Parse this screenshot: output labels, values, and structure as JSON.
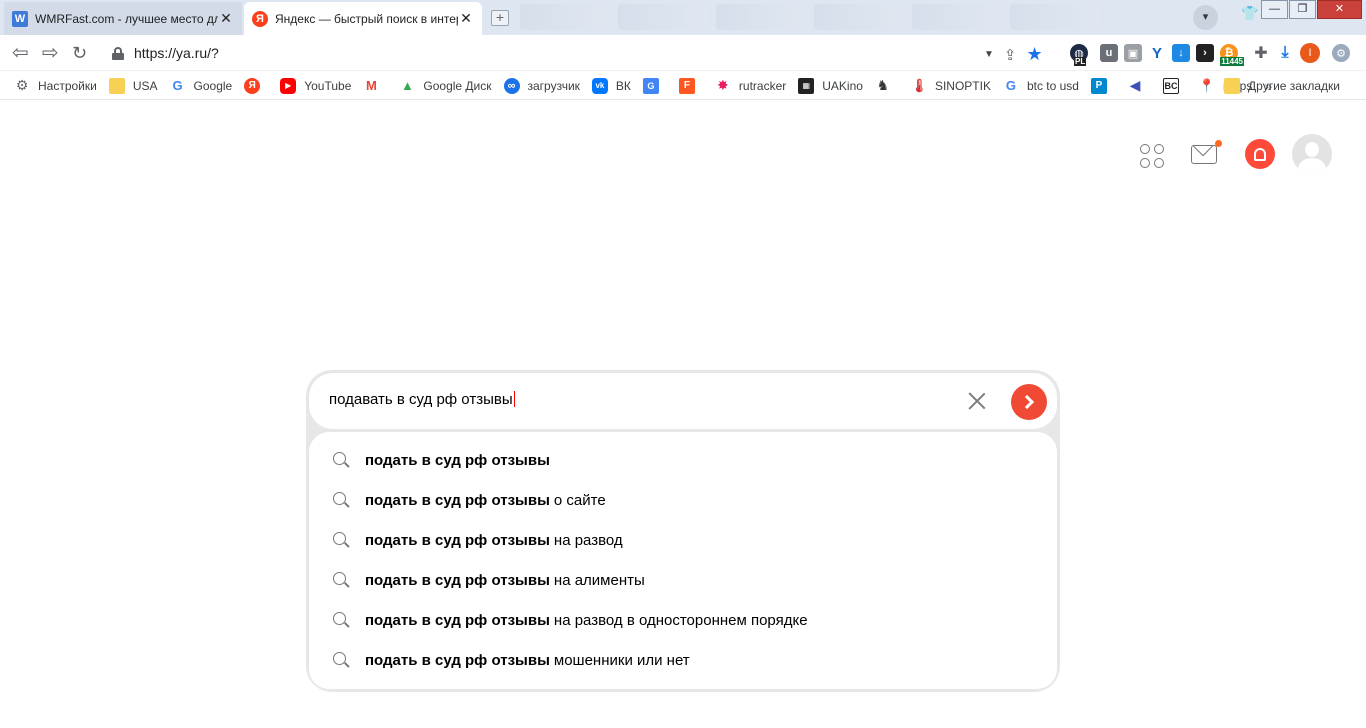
{
  "browser": {
    "tabs": [
      {
        "title": "WMRFast.com - лучшее место для",
        "icon": "wmrfast-favicon",
        "active": false
      },
      {
        "title": "Яндекс — быстрый поиск в интер",
        "icon": "yandex-favicon",
        "active": true
      }
    ],
    "url": "https://ya.ru/?",
    "extension_badge_count": "11445",
    "extension_badge_pl": "PL",
    "profile_initial": "I"
  },
  "bookmarks": [
    {
      "label": "Настройки",
      "icon": "gear-icon",
      "color": "#5f6368"
    },
    {
      "label": "USA",
      "icon": "folder-icon",
      "color": "#f7d154"
    },
    {
      "label": "Google",
      "icon": "google-icon",
      "color": "#4285f4"
    },
    {
      "label": "",
      "icon": "yandex-icon",
      "color": "#fc3f1d"
    },
    {
      "label": "YouTube",
      "icon": "youtube-icon",
      "color": "#ff0000"
    },
    {
      "label": "",
      "icon": "gmail-icon",
      "color": "#ea4335"
    },
    {
      "label": "Google Диск",
      "icon": "drive-icon",
      "color": "#34a853"
    },
    {
      "label": "загрузчик",
      "icon": "infinity-icon",
      "color": "#1a73e8"
    },
    {
      "label": "ВК",
      "icon": "vk-icon",
      "color": "#0077ff"
    },
    {
      "label": "",
      "icon": "translate-icon",
      "color": "#4285f4"
    },
    {
      "label": "",
      "icon": "f-icon",
      "color": "#ff5722"
    },
    {
      "label": "rutracker",
      "icon": "rutracker-icon",
      "color": "#e91e63"
    },
    {
      "label": "UAKino",
      "icon": "uakino-icon",
      "color": "#222222"
    },
    {
      "label": "",
      "icon": "chess-icon",
      "color": "#333333"
    },
    {
      "label": "SINOPTIK",
      "icon": "thermometer-icon",
      "color": "#d32f2f"
    },
    {
      "label": "btc to usd",
      "icon": "google-icon",
      "color": "#4285f4"
    },
    {
      "label": "",
      "icon": "p-icon",
      "color": "#0288d1"
    },
    {
      "label": "",
      "icon": "arrow-icon",
      "color": "#3f51b5"
    },
    {
      "label": "",
      "icon": "bc-icon",
      "color": "#222222"
    },
    {
      "label": "maps",
      "icon": "maps-icon",
      "color": "#34a853"
    }
  ],
  "bookmarks_more": "»",
  "bookmarks_other": "Другие закладки",
  "search": {
    "query": "подавать в суд рф отзывы",
    "suggestions": [
      {
        "bold": "подать в суд рф отзывы",
        "rest": ""
      },
      {
        "bold": "подать в суд рф отзывы",
        "rest": "о сайте"
      },
      {
        "bold": "подать в суд рф отзывы",
        "rest": "на развод"
      },
      {
        "bold": "подать в суд рф отзывы",
        "rest": "на алименты"
      },
      {
        "bold": "подать в суд рф отзывы",
        "rest": "на развод в одностороннем порядке"
      },
      {
        "bold": "подать в суд рф отзывы",
        "rest": "мошенники или нет"
      }
    ]
  },
  "colors": {
    "accent": "#f04a34",
    "alice": "#ff4a3a",
    "mail_dot": "#ff6a1f"
  }
}
